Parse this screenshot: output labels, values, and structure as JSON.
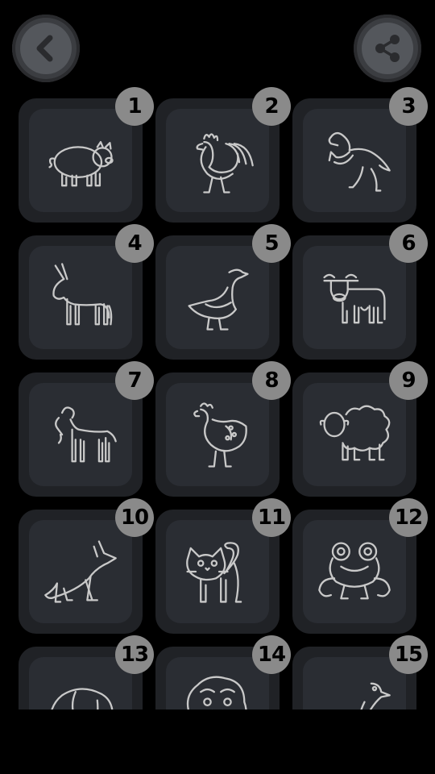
{
  "header": {
    "back_icon": "back-chevron-icon",
    "share_icon": "share-icon"
  },
  "animals": [
    {
      "number": "1",
      "icon": "pig-icon"
    },
    {
      "number": "2",
      "icon": "rooster-icon"
    },
    {
      "number": "3",
      "icon": "horse-icon"
    },
    {
      "number": "4",
      "icon": "donkey-icon"
    },
    {
      "number": "5",
      "icon": "goose-icon"
    },
    {
      "number": "6",
      "icon": "cow-icon"
    },
    {
      "number": "7",
      "icon": "goat-icon"
    },
    {
      "number": "8",
      "icon": "hen-icon"
    },
    {
      "number": "9",
      "icon": "sheep-icon"
    },
    {
      "number": "10",
      "icon": "wolf-icon"
    },
    {
      "number": "11",
      "icon": "cat-icon"
    },
    {
      "number": "12",
      "icon": "frog-icon"
    },
    {
      "number": "13",
      "icon": "elephant-icon"
    },
    {
      "number": "14",
      "icon": "lion-icon"
    },
    {
      "number": "15",
      "icon": "bird-icon"
    }
  ],
  "colors": {
    "background": "#000000",
    "tile": "#2a2d33",
    "badge": "#8a8a8a",
    "icon_stroke": "#c9c9c9"
  }
}
